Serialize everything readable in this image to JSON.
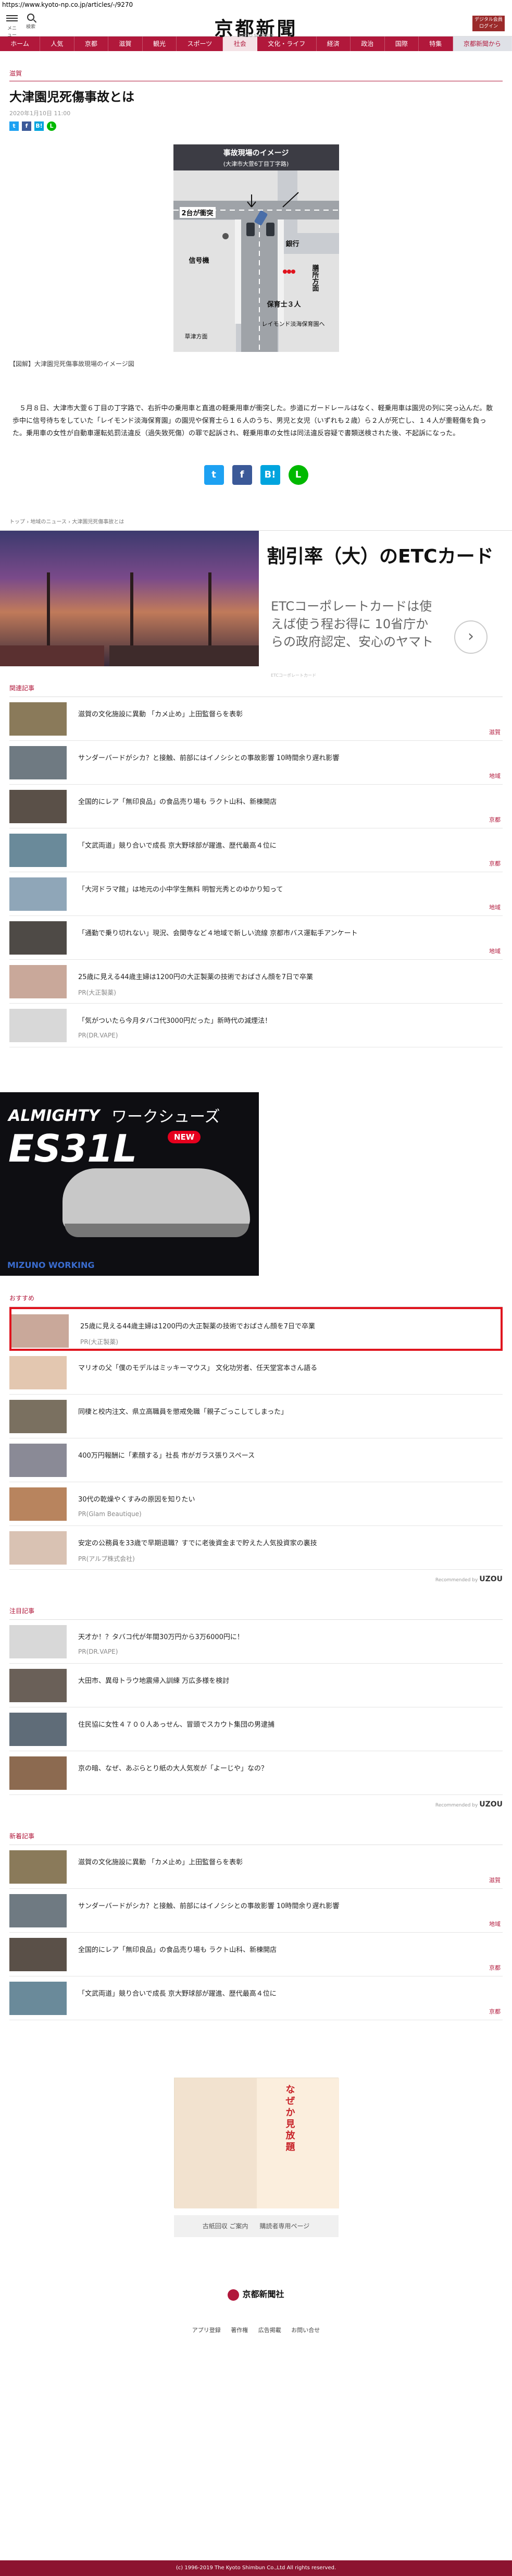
{
  "browser": {
    "url": "https://www.kyoto-np.co.jp/articles/-/9270"
  },
  "header": {
    "menu_label": "メニュー",
    "search_label": "検索",
    "logo": "京都新聞",
    "logo_sub": "KYOTO SHIMBUN",
    "member_button": "デジタル会員 ログイン"
  },
  "nav": {
    "items": [
      "ホーム",
      "人気",
      "京都",
      "滋賀",
      "観光",
      "スポーツ",
      "社会",
      "文化・ライフ",
      "経済",
      "政治",
      "国際",
      "特集",
      "京都新聞から"
    ]
  },
  "article": {
    "section": "滋賀",
    "title": "大津園児死傷事故とは",
    "date": "2020年1月10日 11:00",
    "figure": {
      "heading": "事故現場のイメージ",
      "subheading": "(大津市大萱6丁目丁字路)",
      "labels": {
        "collision": "2台が衝突",
        "building": "銀行",
        "direction": "膳所方面",
        "signal": "信号機",
        "group": "保育士３人",
        "group2": "レイモンド淡海保育園へ",
        "kusatsu": "草津方面"
      }
    },
    "caption": "【図解】大津園児死傷事故現場のイメージ図",
    "body": "　５月８日、大津市大萱６丁目の丁字路で、右折中の乗用車と直進の軽乗用車が衝突した。歩道にガードレールはなく、軽乗用車は園児の列に突っ込んだ。散歩中に信号待ちをしていた「レイモンド淡海保育園」の園児や保育士ら１６人のうち、男児と女児（いずれも２歳）ら２人が死亡し、１４人が重軽傷を負った。乗用車の女性が自動車運転処罰法違反（過失致死傷）の罪で起訴され、軽乗用車の女性は同法違反容疑で書類送検された後、不起訴になった。",
    "share": {
      "twitter": "t",
      "facebook": "f",
      "hatena": "B!",
      "line": "L"
    }
  },
  "breadcrumb": [
    "トップ",
    "地域のニュース",
    "大津園児死傷事故とは"
  ],
  "etc_ad": {
    "title": "割引率（大）のETCカード",
    "desc": "ETCコーポレートカードは使えば使う程お得に 10省庁からの政府認定、安心のヤマト",
    "sub": "ETCコーポレートカード",
    "next": "›"
  },
  "related": {
    "label": "関連記事",
    "items": [
      {
        "title": "滋賀の文化施設に異動 「カメ止め」上田監督らを表彰",
        "cat": "滋賀"
      },
      {
        "title": "サンダーバードがシカ？と接触、前部にはイノシシとの事故影響 10時間余り遅れ影響",
        "cat": "地域"
      },
      {
        "title": "全国的にレア「無印良品」の食品売り場も ラクト山科、新棟開店",
        "cat": "京都"
      },
      {
        "title": "「文武両道」競り合いで成長 京大野球部が躍進、歴代最高４位に",
        "cat": "京都"
      },
      {
        "title": "「大河ドラマ館」は地元の小中学生無料 明智光秀とのゆかり知って",
        "cat": "地域"
      },
      {
        "title": "「通勤で乗り切れない」現況、会関寺など４地域で新しい流線 京都市バス運転手アンケート",
        "cat": "地域"
      },
      {
        "title": "25歳に見える44歳主婦は1200円の大正製薬の技術でおばさん顔を7日で卒業",
        "pr": "PR(大正製薬)"
      },
      {
        "title": "「気がついたら今月タバコ代3000円だった」新時代の減煙法！",
        "pr": "PR(DR.VAPE)"
      }
    ]
  },
  "shoe_ad": {
    "line1": "ALMIGHTY",
    "line2": "ES31L",
    "line3": "ワークシューズ",
    "badge": "NEW",
    "brand": "MIZUNO WORKING"
  },
  "recommend": {
    "label": "おすすめ",
    "items": [
      {
        "title": "25歳に見える44歳主婦は1200円の大正製薬の技術でおばさん顔を7日で卒業",
        "pr": "PR(大正製薬)"
      },
      {
        "title": "マリオの父「僕のモデルはミッキーマウス」 文化功労者、任天堂宮本さん語る"
      },
      {
        "title": "同棲と校内注文、県立高職員を懲戒免職「親子ごっこしてしまった」"
      },
      {
        "title": "400万円報酬に「素顔する」社長 市がガラス張りスペース"
      },
      {
        "title": "30代の乾燥やくすみの原因を知りたい",
        "pr": "PR(Glam Beautique)"
      },
      {
        "title": "安定の公務員を33歳で早期退職？すでに老後資金まで貯えた人気投資家の裏技",
        "pr": "PR(アルプ株式会社)"
      }
    ],
    "sponsor_label": "Recommended by",
    "sponsor_logo": "UZOU"
  },
  "attention": {
    "label": "注目記事",
    "items": [
      {
        "title": "天才か！？タバコ代が年間30万円から3万6000円に！",
        "pr": "PR(DR.VAPE)"
      },
      {
        "title": "大田市、異母トラウ地震帰入訓練 万広多様を検討"
      },
      {
        "title": "住民協に女性４７００人あっせん、冒頭でスカウト集団の男逮捕"
      },
      {
        "title": "京の暗、なぜ、あぶらとり紙の大人気炭が「よーじや」なの？"
      }
    ],
    "sponsor_label": "Recommended by",
    "sponsor_logo": "UZOU"
  },
  "latest": {
    "label": "新着記事",
    "items": [
      {
        "title": "滋賀の文化施設に異動 「カメ止め」上田監督らを表彰",
        "cat": "滋賀"
      },
      {
        "title": "サンダーバードがシカ？と接触、前部にはイノシシとの事故影響 10時間余り遅れ影響",
        "cat": "地域"
      },
      {
        "title": "全国的にレア「無印良品」の食品売り場も ラクト山科、新棟開店",
        "cat": "京都"
      },
      {
        "title": "「文武両道」競り合いで成長 京大野球部が躍進、歴代最高４位に",
        "cat": "京都"
      }
    ]
  },
  "bottom_ad": {
    "text": "なぜか見放題"
  },
  "links": [
    "古紙回収 ご案内",
    "購読者専用ページ"
  ],
  "footer": {
    "logo": "京都新聞社",
    "links": [
      "アプリ登録",
      "著作権",
      "広告掲載",
      "お問い合せ"
    ],
    "copyright": "(c) 1996-2019 The Kyoto Shimbun Co.,Ltd All rights reserved."
  },
  "colors": {
    "brand": "#b1183b",
    "highlight": "#e0141e"
  }
}
